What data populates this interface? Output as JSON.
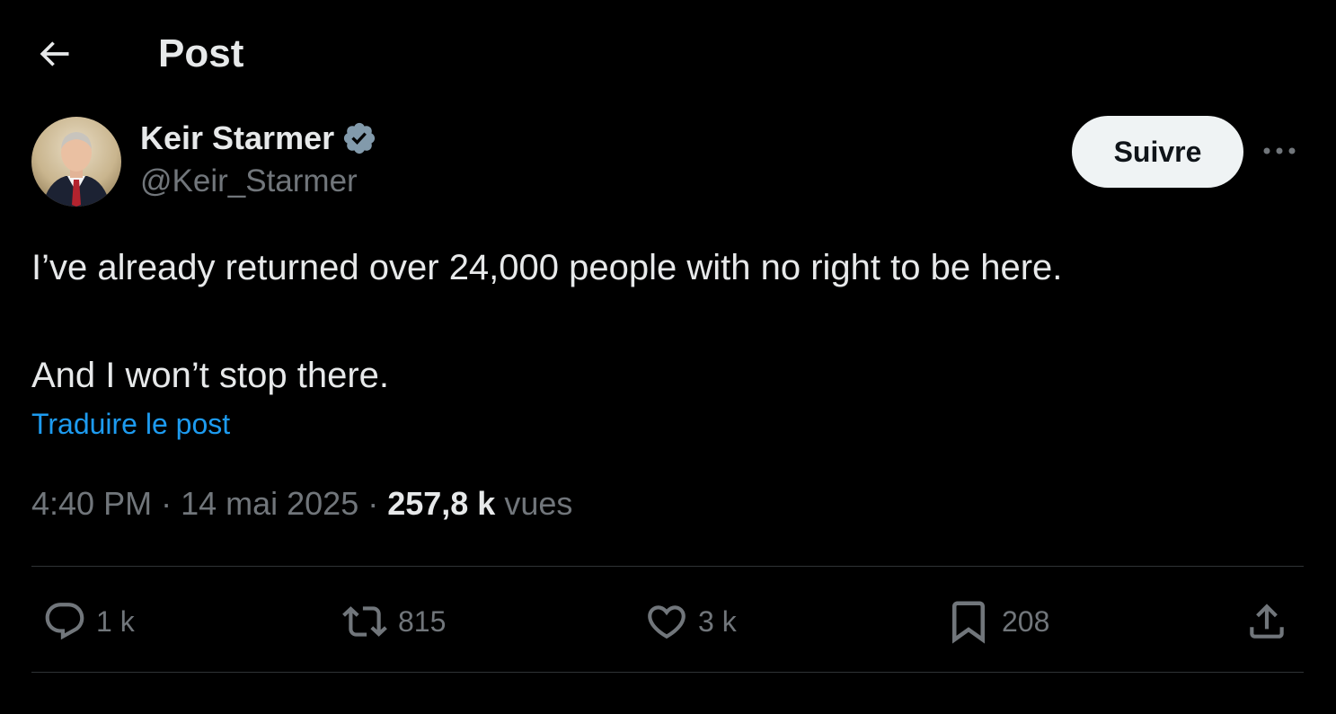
{
  "header": {
    "title": "Post",
    "back_icon": "arrow-left-icon"
  },
  "author": {
    "name": "Keir Starmer",
    "handle": "@Keir_Starmer",
    "verified": true,
    "verified_color": "#829aab"
  },
  "follow_button": {
    "label": "Suivre"
  },
  "tweet": {
    "line1": "I’ve already returned over 24,000 people with no right to be here.",
    "line2": "And I won’t stop there.",
    "translate_label": "Traduire le post"
  },
  "meta": {
    "time": "4:40 PM",
    "date": "14 mai 2025",
    "separator": " · ",
    "views_count": "257,8 k",
    "views_label": "vues"
  },
  "actions": {
    "reply": {
      "icon": "reply-icon",
      "count": "1 k"
    },
    "repost": {
      "icon": "repost-icon",
      "count": "815"
    },
    "like": {
      "icon": "heart-icon",
      "count": "3 k"
    },
    "bookmark": {
      "icon": "bookmark-icon",
      "count": "208"
    },
    "share": {
      "icon": "share-icon"
    }
  },
  "colors": {
    "background": "#000000",
    "text_primary": "#e7e9ea",
    "text_secondary": "#71767b",
    "link": "#1d9bf0",
    "divider": "#2f3336",
    "follow_bg": "#eff3f4"
  }
}
